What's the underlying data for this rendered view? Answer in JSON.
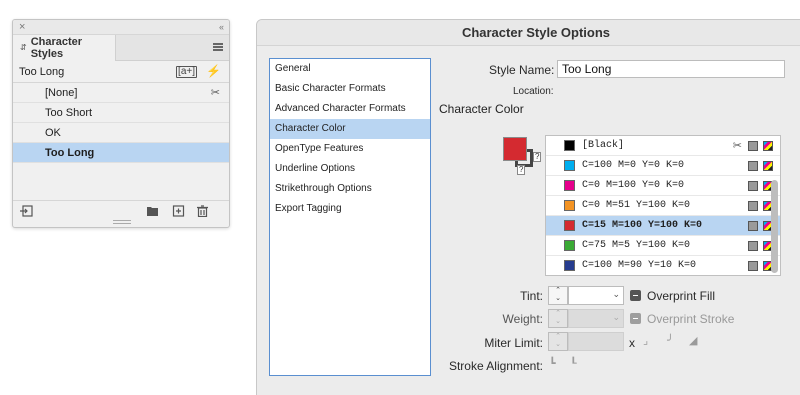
{
  "character_styles_panel": {
    "tab_label": "Character Styles",
    "current_style": "Too Long",
    "items": [
      {
        "label": "[None]",
        "selected": false,
        "icon": "no-edit-icon"
      },
      {
        "label": "Too Short",
        "selected": false
      },
      {
        "label": "OK",
        "selected": false
      },
      {
        "label": "Too Long",
        "selected": true
      }
    ],
    "icons": {
      "close": "×",
      "collapse": "‹‹",
      "new_from_selection": "a+",
      "quick_apply": "⚡",
      "no_edit": "✂"
    }
  },
  "dialog": {
    "title": "Character Style Options",
    "nav": [
      {
        "label": "General",
        "selected": false
      },
      {
        "label": "Basic Character Formats",
        "selected": false
      },
      {
        "label": "Advanced Character Formats",
        "selected": false
      },
      {
        "label": "Character Color",
        "selected": true
      },
      {
        "label": "OpenType Features",
        "selected": false
      },
      {
        "label": "Underline Options",
        "selected": false
      },
      {
        "label": "Strikethrough Options",
        "selected": false
      },
      {
        "label": "Export Tagging",
        "selected": false
      }
    ],
    "style_name_label": "Style Name:",
    "style_name_value": "Too Long",
    "location_label": "Location:",
    "section_title": "Character Color",
    "fill_color": "#d42a30",
    "question_mark": "?",
    "swatches": [
      {
        "name": "[Black]",
        "color": "#000000",
        "selected": false,
        "no_edit": true
      },
      {
        "name": "C=100 M=0 Y=0 K=0",
        "color": "#00aeef",
        "selected": false
      },
      {
        "name": "C=0 M=100 Y=0 K=0",
        "color": "#e6008c",
        "selected": false
      },
      {
        "name": "C=0 M=51 Y=100 K=0",
        "color": "#f39323",
        "selected": false
      },
      {
        "name": "C=15 M=100 Y=100 K=0",
        "color": "#d42a30",
        "selected": true
      },
      {
        "name": "C=75 M=5 Y=100 K=0",
        "color": "#3aaa35",
        "selected": false
      },
      {
        "name": "C=100 M=90 Y=10 K=0",
        "color": "#263c8f",
        "selected": false
      }
    ],
    "tint_label": "Tint:",
    "tint_value": "",
    "overprint_fill_label": "Overprint Fill",
    "weight_label": "Weight:",
    "overprint_stroke_label": "Overprint Stroke",
    "miter_limit_label": "Miter Limit:",
    "miter_x": "x",
    "stroke_alignment_label": "Stroke Alignment:"
  }
}
